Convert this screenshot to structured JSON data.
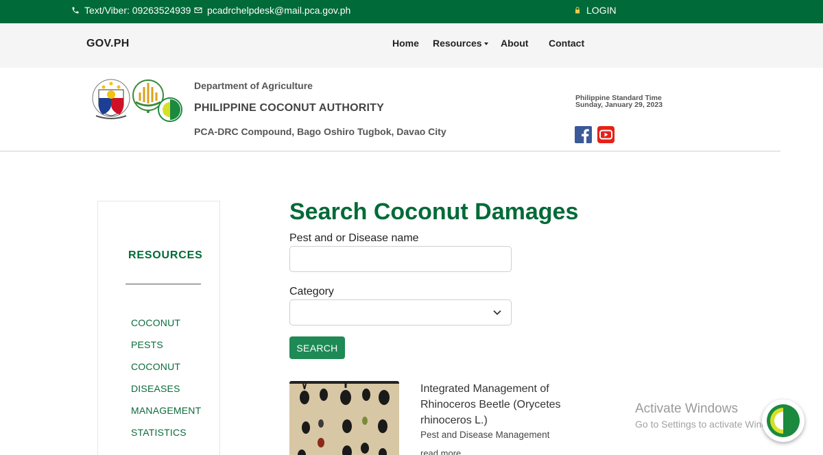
{
  "topbar": {
    "phone": "Text/Viber: 09263524939",
    "email": "pcadrchelpdesk@mail.pca.gov.ph",
    "login": "LOGIN"
  },
  "navbar": {
    "brand": "GOV.PH",
    "links": [
      "Home",
      "Resources",
      "About",
      "Contact"
    ]
  },
  "header": {
    "department": "Department of Agriculture",
    "agency": "PHILIPPINE COCONUT AUTHORITY",
    "address": "PCA-DRC Compound, Bago Oshiro Tugbok, Davao City",
    "pst_label": "Philippine Standard Time",
    "pst_date": "Sunday, January 29, 2023"
  },
  "sidebar": {
    "title": "RESOURCES",
    "links": [
      "COCONUT",
      "PESTS",
      "COCONUT",
      "DISEASES",
      "MANAGEMENT",
      "STATISTICS"
    ]
  },
  "main": {
    "title": "Search Coconut Damages",
    "name_label": "Pest and or Disease name",
    "name_value": "",
    "category_label": "Category",
    "category_value": "",
    "search_button": "SEARCH"
  },
  "result": {
    "title": "Integrated Management of Rhinoceros Beetle (Orycetes rhinoceros L.)",
    "category": "Pest and Disease Management",
    "read_more": "read more"
  },
  "watermark": {
    "line1": "Activate Windows",
    "line2": "Go to Settings to activate Windows."
  },
  "colors": {
    "brand_green": "#006a38",
    "button_green": "#1e8a55",
    "facebook_blue": "#3b5998",
    "youtube_red": "#e62117"
  },
  "icons": [
    "phone-icon",
    "mail-icon",
    "lock-icon",
    "facebook-icon",
    "youtube-icon",
    "chevron-down-icon"
  ]
}
